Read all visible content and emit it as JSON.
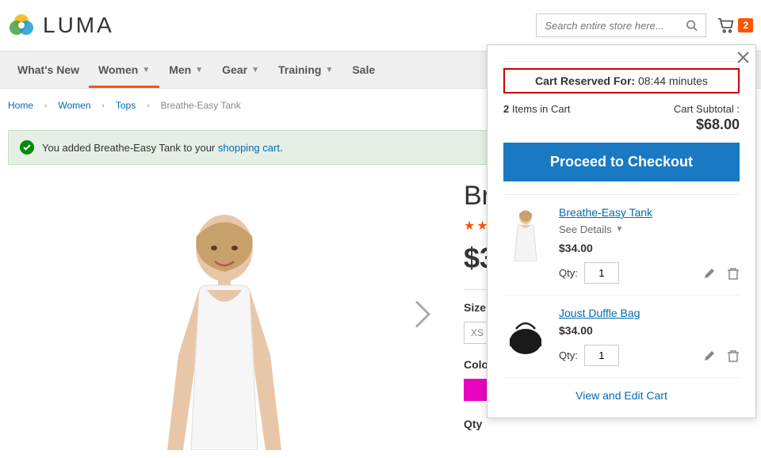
{
  "logo_text": "LUMA",
  "search": {
    "placeholder": "Search entire store here..."
  },
  "cart_count": "2",
  "nav": {
    "whats_new": "What's New",
    "women": "Women",
    "men": "Men",
    "gear": "Gear",
    "training": "Training",
    "sale": "Sale"
  },
  "breadcrumb": {
    "home": "Home",
    "women": "Women",
    "tops": "Tops",
    "current": "Breathe-Easy Tank"
  },
  "notice": {
    "prefix": "You added Breathe-Easy Tank to your ",
    "link": "shopping cart",
    "suffix": "."
  },
  "product": {
    "title": "Br",
    "price": "$3",
    "size_label": "Size",
    "size_value": "XS",
    "color_label": "Color",
    "qty_label": "Qty"
  },
  "minicart": {
    "reserved_label": "Cart Reserved For:",
    "reserved_time": "08:44 minutes",
    "items_count": "2",
    "items_in_cart": " Items in Cart",
    "subtotal_label": "Cart Subtotal :",
    "subtotal": "$68.00",
    "checkout": "Proceed to Checkout",
    "qty_label": "Qty:",
    "see_details": "See Details",
    "view_edit": "View and Edit Cart",
    "items": [
      {
        "name": "Breathe-Easy Tank",
        "price": "$34.00",
        "qty": "1",
        "has_details": true
      },
      {
        "name": "Joust Duffle Bag",
        "price": "$34.00",
        "qty": "1",
        "has_details": false
      }
    ]
  }
}
